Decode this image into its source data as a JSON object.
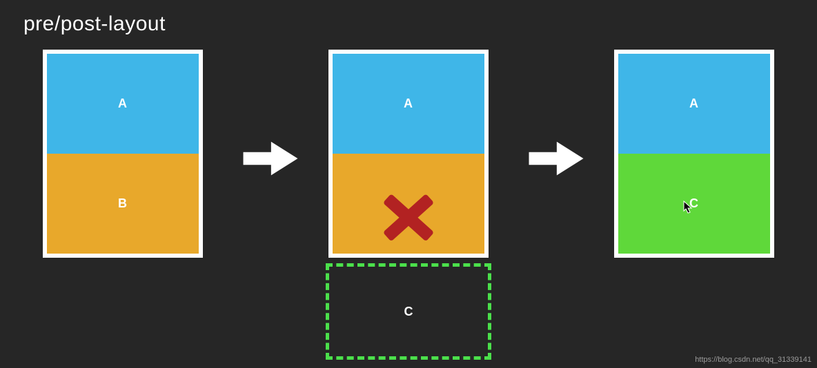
{
  "title": "pre/post-layout",
  "panels": {
    "left": {
      "top": "A",
      "bottom": "B"
    },
    "middle": {
      "top": "A",
      "bottom": ""
    },
    "right": {
      "top": "A",
      "bottom": "C"
    }
  },
  "pending_label": "C",
  "watermark": "https://blog.csdn.net/qq_31339141",
  "colors": {
    "bg": "#262626",
    "blue": "#3fb6e8",
    "orange": "#e8a82b",
    "green": "#5fd83a",
    "cross": "#b22222",
    "dash": "#4be04b"
  }
}
